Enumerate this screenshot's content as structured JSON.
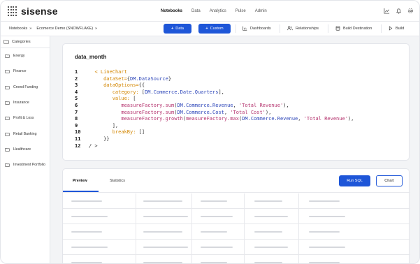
{
  "app": {
    "logo_text": "sisense"
  },
  "topnav": {
    "tabs": [
      {
        "label": "Notebooks",
        "active": true
      },
      {
        "label": "Data",
        "active": false
      },
      {
        "label": "Analytics",
        "active": false
      },
      {
        "label": "Pulse",
        "active": false
      },
      {
        "label": "Admin",
        "active": false
      }
    ],
    "icons": [
      "chart-icon",
      "bell-icon",
      "gear-icon"
    ]
  },
  "toolbar": {
    "breadcrumb": [
      {
        "label": "Notebooks",
        "suffix": "»"
      },
      {
        "label": "Ecomerce Demo (SNOWFLAKE)",
        "suffix": "»"
      }
    ],
    "data_button": "Data",
    "custom_button": "Custom",
    "dashboards_label": "Dashboards",
    "relationships_label": "Relationships",
    "build_destination_label": "Build Destination",
    "build_label": "Build"
  },
  "sidebar": {
    "header": "Categories",
    "items": [
      "Energy",
      "Finance",
      "Crowd Funding",
      "Insurance",
      "Profit & Loss",
      "Retail Banking",
      "Healthcare",
      "Investment Portfolio"
    ]
  },
  "code_card": {
    "title": "data_month",
    "lines": [
      {
        "n": "1",
        "tokens": [
          [
            "",
            "  "
          ],
          [
            "#d38600",
            "< LineChart"
          ]
        ]
      },
      {
        "n": "2",
        "tokens": [
          [
            "",
            "     "
          ],
          [
            "#d38600",
            "dataSet="
          ],
          [
            "#333333",
            "{"
          ],
          [
            "#2d46b9",
            "DM.DataSource"
          ],
          [
            "#333333",
            "}"
          ]
        ]
      },
      {
        "n": "3",
        "tokens": [
          [
            "",
            "     "
          ],
          [
            "#d38600",
            "dataOptions="
          ],
          [
            "#333333",
            "{{"
          ]
        ]
      },
      {
        "n": "4",
        "tokens": [
          [
            "",
            "        "
          ],
          [
            "#d38600",
            "category: "
          ],
          [
            "#333333",
            "["
          ],
          [
            "#2d46b9",
            "DM.Commerce.Date.Quarters"
          ],
          [
            "#333333",
            "],"
          ]
        ]
      },
      {
        "n": "5",
        "tokens": [
          [
            "",
            "        "
          ],
          [
            "#d38600",
            "value: "
          ],
          [
            "#333333",
            "["
          ]
        ]
      },
      {
        "n": "6",
        "tokens": [
          [
            "",
            "           "
          ],
          [
            "#b4326d",
            "measureFactory.sum"
          ],
          [
            "#333333",
            "("
          ],
          [
            "#2d46b9",
            "DM.Commerce.Revenue"
          ],
          [
            "#333333",
            ", "
          ],
          [
            "#b4326d",
            "'Total Revenue'"
          ],
          [
            "#333333",
            "),"
          ]
        ]
      },
      {
        "n": "7",
        "tokens": [
          [
            "",
            "           "
          ],
          [
            "#b4326d",
            "measureFactory.sum"
          ],
          [
            "#333333",
            "("
          ],
          [
            "#2d46b9",
            "DM.Commerce.Cost"
          ],
          [
            "#333333",
            ", "
          ],
          [
            "#b4326d",
            "'Total Cost'"
          ],
          [
            "#333333",
            "),"
          ]
        ]
      },
      {
        "n": "8",
        "tokens": [
          [
            "",
            "           "
          ],
          [
            "#b4326d",
            "measureFactory.growth"
          ],
          [
            "#333333",
            "("
          ],
          [
            "#b4326d",
            "measureFactory.max"
          ],
          [
            "#333333",
            "("
          ],
          [
            "#2d46b9",
            "DM.Commerce.Revenue"
          ],
          [
            "#333333",
            ", "
          ],
          [
            "#b4326d",
            "'Total Revenue'"
          ],
          [
            "#333333",
            "),"
          ]
        ]
      },
      {
        "n": "9",
        "tokens": [
          [
            "",
            "        "
          ],
          [
            "#333333",
            "],"
          ]
        ]
      },
      {
        "n": "10",
        "tokens": [
          [
            "",
            "        "
          ],
          [
            "#d38600",
            "breakBy: "
          ],
          [
            "#333333",
            "[]"
          ]
        ]
      },
      {
        "n": "11",
        "tokens": [
          [
            "",
            "     "
          ],
          [
            "#333333",
            "}}"
          ]
        ]
      },
      {
        "n": "12",
        "tokens": [
          [
            "#333333",
            "/ >"
          ]
        ]
      }
    ]
  },
  "bottom_card": {
    "tabs": [
      {
        "label": "Preview",
        "active": true
      },
      {
        "label": "Statistics",
        "active": false
      }
    ],
    "run_sql_button": "Run SQL",
    "chart_button": "Chart"
  },
  "colors": {
    "accent": "#1e56d8",
    "code_keyword": "#d38600",
    "code_reference": "#2d46b9",
    "code_function": "#b4326d"
  }
}
